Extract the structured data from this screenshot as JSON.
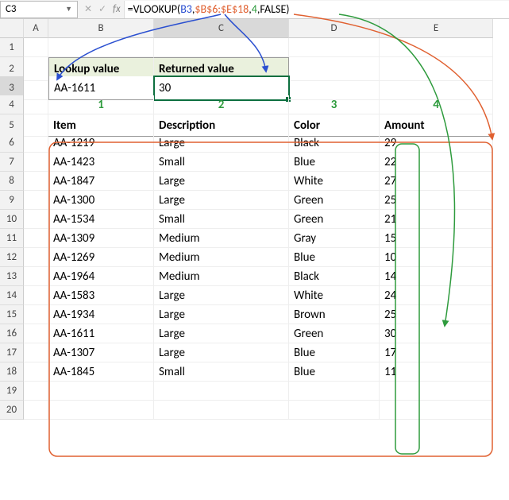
{
  "namebox": {
    "value": "C3"
  },
  "formula_bar": {
    "prefix": "=VLOOKUP(",
    "arg1": "B3",
    "c1": ",",
    "arg2": "$B$6:$E$18",
    "c2": ",",
    "arg3": "4",
    "c3": ",",
    "arg4": "FALSE",
    "suffix": ")"
  },
  "col_labels": [
    "A",
    "B",
    "C",
    "D",
    "E"
  ],
  "row_labels": [
    "1",
    "2",
    "3",
    "4",
    "5",
    "6",
    "7",
    "8",
    "9",
    "10",
    "11",
    "12",
    "13",
    "14",
    "15",
    "16",
    "17",
    "18",
    "19",
    "20"
  ],
  "lookup": {
    "label_lookup": "Lookup value",
    "label_returned": "Returned value",
    "value": "AA-1611",
    "returned": "30"
  },
  "column_numbers": [
    "1",
    "2",
    "3",
    "4"
  ],
  "table": {
    "headers": {
      "item": "Item",
      "description": "Description",
      "color": "Color",
      "amount": "Amount"
    },
    "rows": [
      {
        "item": "AA-1219",
        "description": "Large",
        "color": "Black",
        "amount": "29"
      },
      {
        "item": "AA-1423",
        "description": "Small",
        "color": "Blue",
        "amount": "22"
      },
      {
        "item": "AA-1847",
        "description": "Large",
        "color": "White",
        "amount": "27"
      },
      {
        "item": "AA-1300",
        "description": "Large",
        "color": "Green",
        "amount": "25"
      },
      {
        "item": "AA-1534",
        "description": "Small",
        "color": "Green",
        "amount": "21"
      },
      {
        "item": "AA-1309",
        "description": "Medium",
        "color": "Gray",
        "amount": "15"
      },
      {
        "item": "AA-1269",
        "description": "Medium",
        "color": "Blue",
        "amount": "10"
      },
      {
        "item": "AA-1964",
        "description": "Medium",
        "color": "Black",
        "amount": "14"
      },
      {
        "item": "AA-1583",
        "description": "Large",
        "color": "White",
        "amount": "24"
      },
      {
        "item": "AA-1934",
        "description": "Large",
        "color": "Brown",
        "amount": "25"
      },
      {
        "item": "AA-1611",
        "description": "Large",
        "color": "Green",
        "amount": "30"
      },
      {
        "item": "AA-1307",
        "description": "Large",
        "color": "Blue",
        "amount": "17"
      },
      {
        "item": "AA-1845",
        "description": "Small",
        "color": "Blue",
        "amount": "11"
      }
    ]
  },
  "colors": {
    "arg_blue": "#2a4fd0",
    "arg_red": "#e06030",
    "arg_green": "#2e9b3d",
    "sel": "#0d6f3f"
  }
}
